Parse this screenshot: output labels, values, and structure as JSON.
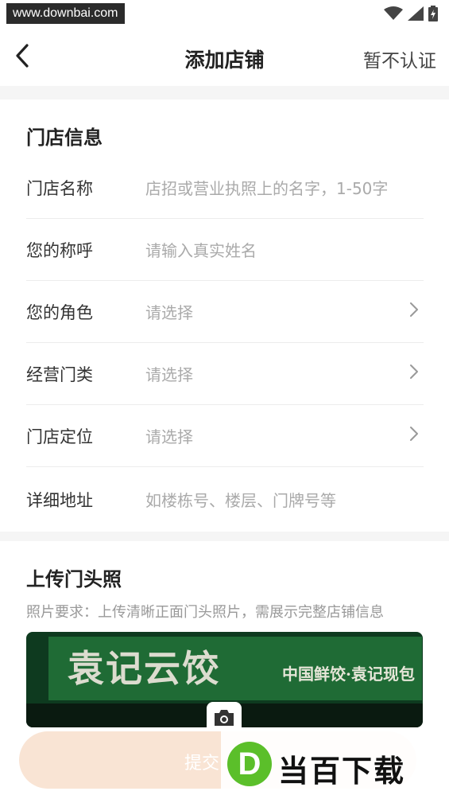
{
  "status_bar": {
    "watermark": "www.downbai.com"
  },
  "nav": {
    "title": "添加店铺",
    "right_action": "暂不认证"
  },
  "store_info": {
    "title": "门店信息",
    "rows": [
      {
        "label": "门店名称",
        "value": "店招或营业执照上的名字，1-50字",
        "chevron": false
      },
      {
        "label": "您的称呼",
        "value": "请输入真实姓名",
        "chevron": false
      },
      {
        "label": "您的角色",
        "value": "请选择",
        "chevron": true
      },
      {
        "label": "经营门类",
        "value": "请选择",
        "chevron": true
      },
      {
        "label": "门店定位",
        "value": "请选择",
        "chevron": true
      },
      {
        "label": "详细地址",
        "value": "如楼栋号、楼层、门牌号等",
        "chevron": false
      }
    ]
  },
  "upload": {
    "title": "上传门头照",
    "description": "照片要求：上传清晰正面门头照片，需展示完整店铺信息",
    "photo_sign_main": "袁记云饺",
    "photo_sign_sub": "中国鲜饺·袁记现包"
  },
  "submit": {
    "label": "提交"
  },
  "logo_watermark": {
    "letter": "D",
    "text": "当百下载"
  },
  "colors": {
    "accent_submit": "#f9e4d4",
    "logo_green": "#5bbf2a"
  }
}
